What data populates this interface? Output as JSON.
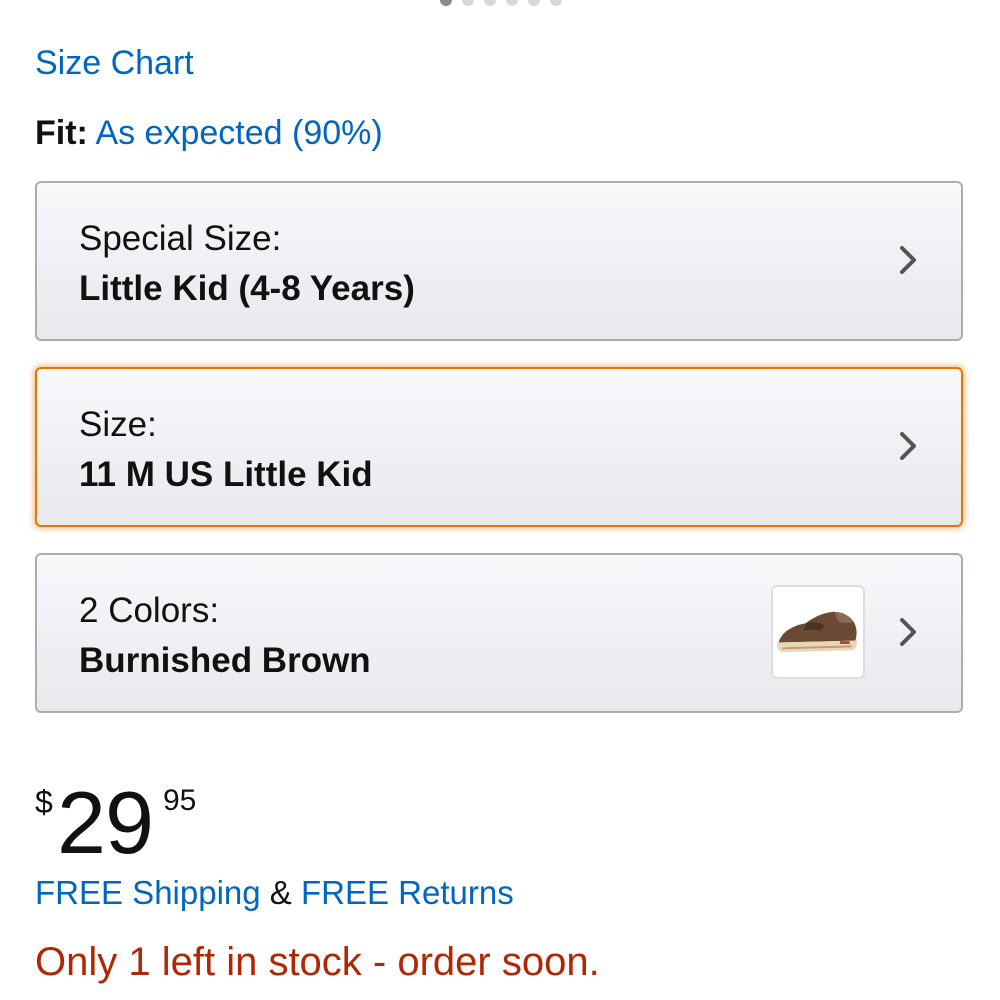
{
  "carousel": {
    "dot_count": 6,
    "active_index": 0
  },
  "size_chart_link": "Size Chart",
  "fit": {
    "label": "Fit:",
    "value": "As expected (90%)"
  },
  "selectors": {
    "special_size": {
      "label": "Special Size:",
      "value": "Little Kid (4-8 Years)",
      "icon": "chevron-right-icon"
    },
    "size": {
      "label": "Size:",
      "value": "11 M US Little Kid",
      "icon": "chevron-right-icon",
      "active": true
    },
    "color": {
      "label": "2 Colors:",
      "value": "Burnished Brown",
      "thumbnail": "brown-shoe",
      "icon": "chevron-right-icon"
    }
  },
  "price": {
    "currency": "$",
    "whole": "29",
    "fraction": "95"
  },
  "shipping": {
    "free_shipping": "FREE Shipping",
    "conjunction": "&",
    "free_returns": "FREE Returns"
  },
  "stock_message": "Only 1 left in stock - order soon.",
  "colors": {
    "link": "#0066c0",
    "stock": "#b12704",
    "active_border": "#e77600",
    "border": "#a9acb1"
  }
}
